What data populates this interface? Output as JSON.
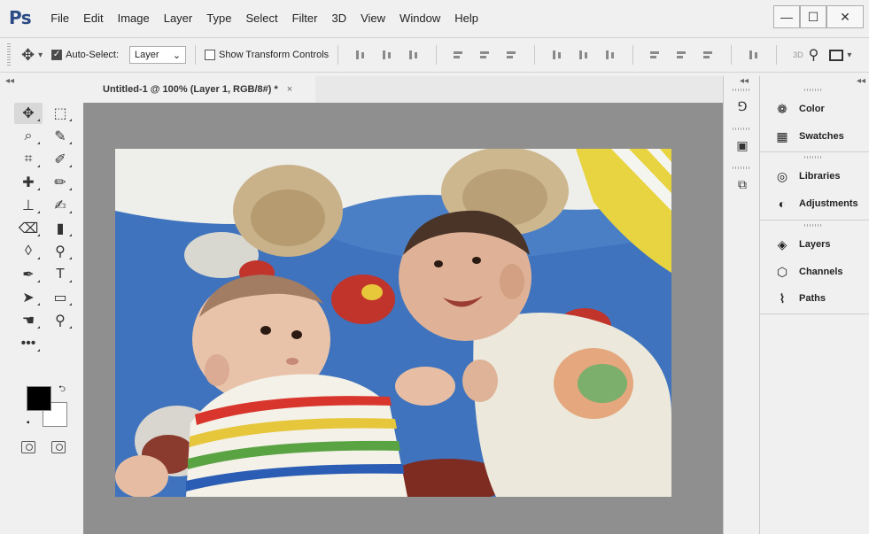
{
  "app": {
    "logo": "Ps"
  },
  "menu": [
    "File",
    "Edit",
    "Image",
    "Layer",
    "Type",
    "Select",
    "Filter",
    "3D",
    "View",
    "Window",
    "Help"
  ],
  "window_controls": {
    "minimize": "—",
    "maximize": "☐",
    "close": "✕"
  },
  "options_bar": {
    "auto_select_label": "Auto-Select:",
    "auto_select_checked": true,
    "auto_select_target": "Layer",
    "show_transform_label": "Show Transform Controls",
    "show_transform_checked": false,
    "mode_3d_label": "3D"
  },
  "document": {
    "tab_title": "Untitled-1 @ 100% (Layer 1, RGB/8#) *",
    "close_glyph": "×"
  },
  "colors": {
    "foreground": "#000000",
    "background": "#ffffff",
    "canvas_bg": "#8f8f8f"
  },
  "tools": [
    {
      "name": "move-tool",
      "glyph": "✥"
    },
    {
      "name": "marquee-tool",
      "glyph": "⬚"
    },
    {
      "name": "lasso-tool",
      "glyph": "⌕"
    },
    {
      "name": "quick-selection-tool",
      "glyph": "✎"
    },
    {
      "name": "crop-tool",
      "glyph": "⌗"
    },
    {
      "name": "eyedropper-tool",
      "glyph": "✐"
    },
    {
      "name": "healing-brush-tool",
      "glyph": "✚"
    },
    {
      "name": "brush-tool",
      "glyph": "✏"
    },
    {
      "name": "clone-stamp-tool",
      "glyph": "⊥"
    },
    {
      "name": "history-brush-tool",
      "glyph": "✍"
    },
    {
      "name": "eraser-tool",
      "glyph": "⌫"
    },
    {
      "name": "gradient-tool",
      "glyph": "▮"
    },
    {
      "name": "blur-tool",
      "glyph": "◊"
    },
    {
      "name": "dodge-tool",
      "glyph": "⚲"
    },
    {
      "name": "pen-tool",
      "glyph": "✒"
    },
    {
      "name": "type-tool",
      "glyph": "T"
    },
    {
      "name": "path-selection-tool",
      "glyph": "➤"
    },
    {
      "name": "rectangle-tool",
      "glyph": "▭"
    },
    {
      "name": "hand-tool",
      "glyph": "☚"
    },
    {
      "name": "zoom-tool",
      "glyph": "⚲"
    },
    {
      "name": "edit-toolbar",
      "glyph": "•••"
    }
  ],
  "right_panels": [
    {
      "name": "color",
      "label": "Color",
      "icon": "palette-icon"
    },
    {
      "name": "swatches",
      "label": "Swatches",
      "icon": "grid-icon"
    },
    {
      "name": "libraries",
      "label": "Libraries",
      "icon": "libraries-icon"
    },
    {
      "name": "adjustments",
      "label": "Adjustments",
      "icon": "adjustments-icon"
    },
    {
      "name": "layers",
      "label": "Layers",
      "icon": "layers-icon"
    },
    {
      "name": "channels",
      "label": "Channels",
      "icon": "channels-icon"
    },
    {
      "name": "paths",
      "label": "Paths",
      "icon": "paths-icon"
    }
  ],
  "collapse_glyph": "◂◂"
}
